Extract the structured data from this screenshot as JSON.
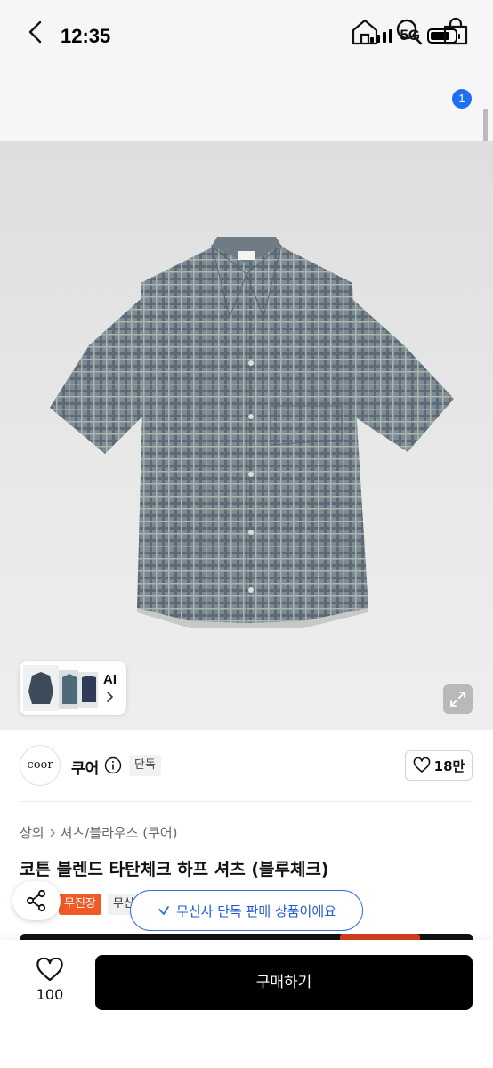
{
  "status_bar": {
    "time": "12:35",
    "network": "5G"
  },
  "nav": {
    "cart_count": "1",
    "icons": [
      "chevron-left-icon",
      "home-icon",
      "search-icon",
      "shopping-bag-icon"
    ]
  },
  "gallery": {
    "ai_label": "AI"
  },
  "brand": {
    "logo_text": "coor",
    "name": "쿠어",
    "exclusive_badge": "단독",
    "likes": "18만"
  },
  "breadcrumb": {
    "category": "상의",
    "subcategory": "셔츠/블라우스 (쿠어)"
  },
  "product": {
    "title": "코튼 블렌드 타탄체크 하프 셔츠 (블루체크)"
  },
  "tags": {
    "primary": "무진장",
    "secondary": "무신"
  },
  "toast": {
    "text": "무신사 단독 판매 상품이에요"
  },
  "bottom_bar": {
    "favorite_count": "100",
    "buy_label": "구매하기"
  },
  "colors": {
    "accent_blue": "#2f6ce0",
    "tag_orange": "#f15a24",
    "buy_bg": "#000000"
  }
}
